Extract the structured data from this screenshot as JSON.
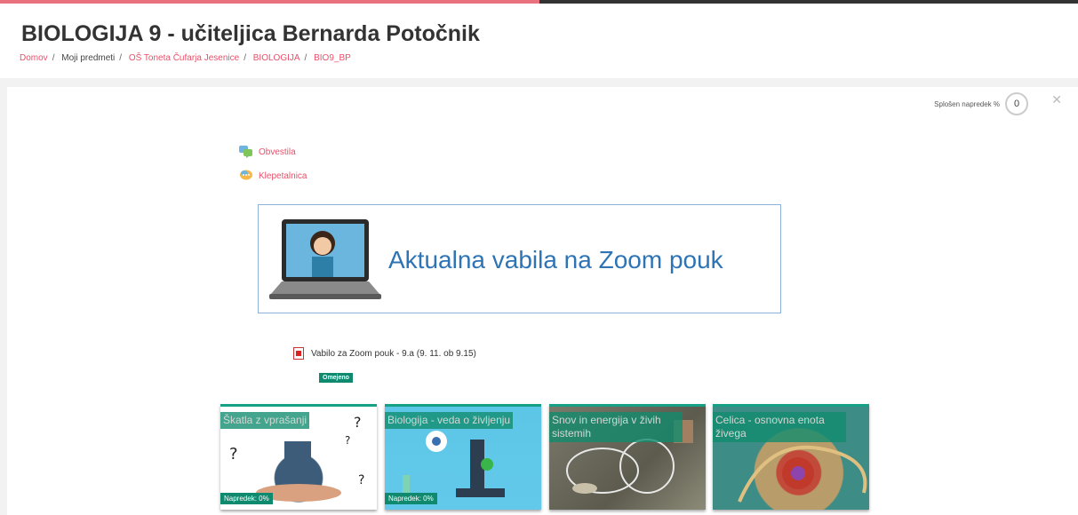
{
  "course_title": "BIOLOGIJA 9 - učiteljica Bernarda Potočnik",
  "breadcrumb": [
    "Domov",
    "Moji predmeti",
    "OŠ Toneta Čufarja Jesenice",
    "BIOLOGIJA",
    "BIO9_BP"
  ],
  "overall_progress": {
    "label": "Splošen napredek %",
    "value": "0"
  },
  "top_progress_fraction": 0.5,
  "activities": [
    {
      "label": "Obvestila",
      "icon": "forum-icon"
    },
    {
      "label": "Klepetalnica",
      "icon": "chat-icon"
    }
  ],
  "banner": {
    "text": "Aktualna vabila na Zoom pouk"
  },
  "file": {
    "label": "Vabilo za Zoom pouk - 9.a (9. 11. ob 9.15)",
    "icon": "pdf-icon"
  },
  "restricted_badge": "Omejeno",
  "tiles": [
    {
      "title": "Škatla z vprašanji",
      "progress": "Napredek: 0%"
    },
    {
      "title": "Biologija - veda o življenju",
      "progress": "Napredek: 0%"
    },
    {
      "title": "Snov in energija v živih sistemih",
      "progress": ""
    },
    {
      "title": "Celica - osnovna enota živega",
      "progress": ""
    }
  ],
  "colors": {
    "accent": "#e8506a",
    "teal": "#0f8a6f",
    "banner_text": "#2e74b5"
  }
}
